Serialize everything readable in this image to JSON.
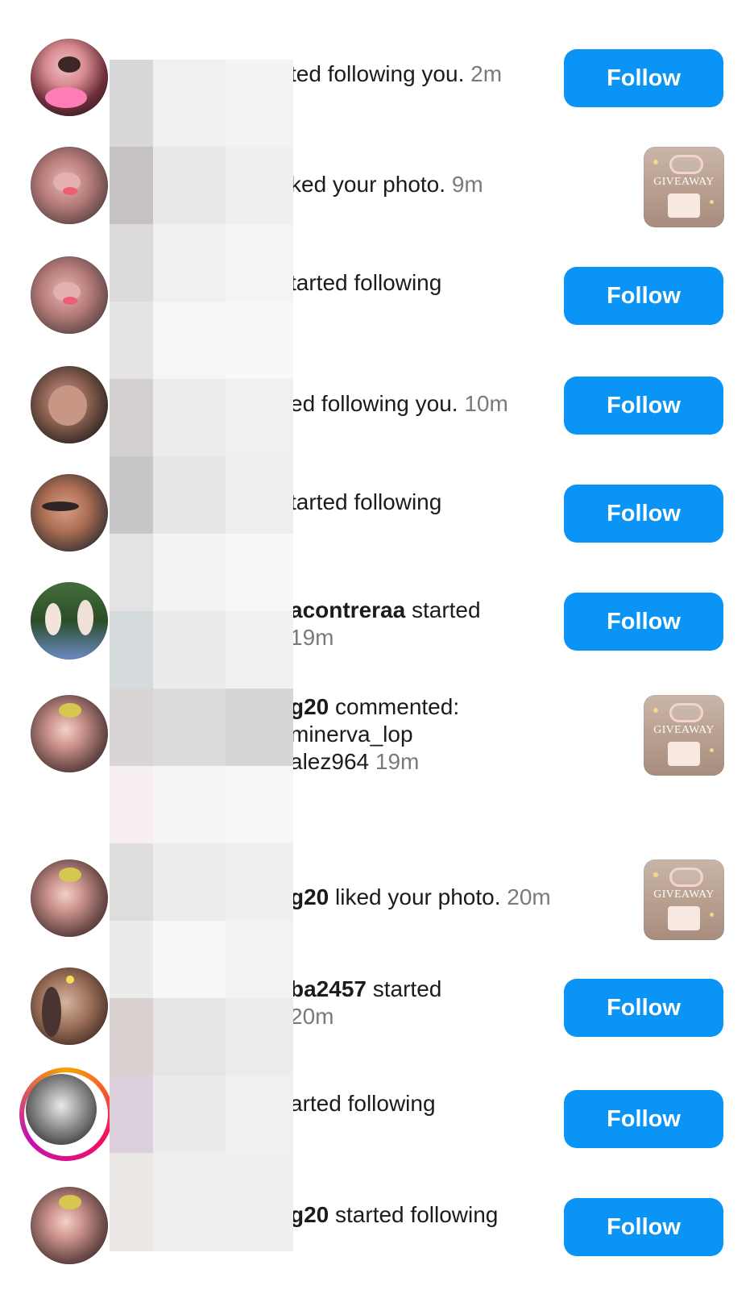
{
  "rows": [
    {
      "text_prefix": "",
      "username": "",
      "text_main": "ted following you.",
      "time": "2m",
      "action": "follow",
      "button_label": "Follow"
    },
    {
      "text_prefix": "",
      "username": "",
      "text_main": "ked your photo.",
      "time": "9m",
      "action": "thumb",
      "thumbnail_text": "GIVEAWAY"
    },
    {
      "text_prefix": "",
      "username": "",
      "text_main": "tarted following",
      "time": "",
      "action": "follow",
      "button_label": "Follow"
    },
    {
      "text_prefix": "",
      "username": "",
      "text_main": "ed following you.",
      "time": "10m",
      "action": "follow",
      "button_label": "Follow"
    },
    {
      "text_prefix": "",
      "username": "",
      "text_main": "tarted following",
      "time": "",
      "action": "follow",
      "button_label": "Follow"
    },
    {
      "text_prefix": "",
      "username": "acontreraa",
      "text_main": " started",
      "time": "19m",
      "action": "follow",
      "button_label": "Follow"
    },
    {
      "text_prefix": "",
      "username": "g20",
      "text_main": " commented:",
      "line2": "minerva_lop",
      "line3": "alez964",
      "time": "19m",
      "action": "thumb",
      "thumbnail_text": "GIVEAWAY"
    },
    {
      "text_prefix": "",
      "username": "g20",
      "text_main": " liked your photo.",
      "time": "20m",
      "action": "thumb",
      "thumbnail_text": "GIVEAWAY"
    },
    {
      "text_prefix": "",
      "username": "ba2457",
      "text_main": " started",
      "time": "20m",
      "action": "follow",
      "button_label": "Follow"
    },
    {
      "text_prefix": "",
      "username": "",
      "text_main": "arted following",
      "time": "",
      "action": "follow",
      "button_label": "Follow"
    },
    {
      "text_prefix": "",
      "username": "g20",
      "text_main": " started following",
      "time": "",
      "action": "follow",
      "button_label": "Follow"
    }
  ],
  "colors": {
    "primary": "#0a95f6",
    "text": "#1b1b1b",
    "muted": "#7a7a7a",
    "story_ring": "#f40e5f"
  }
}
